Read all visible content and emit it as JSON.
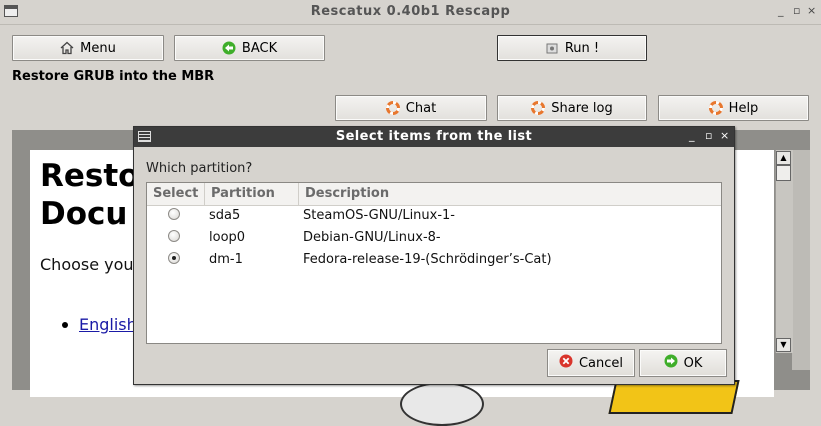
{
  "window": {
    "title": "Rescatux 0.40b1 Rescapp",
    "controls": [
      "_",
      "▫",
      "×"
    ]
  },
  "toolbar": {
    "menu_label": "Menu",
    "back_label": "BACK",
    "run_label": "Run !"
  },
  "page_heading": "Restore GRUB into the MBR",
  "actions": {
    "chat_label": "Chat",
    "share_log_label": "Share log",
    "help_label": "Help"
  },
  "browser": {
    "heading_line1": "Resto",
    "heading_line2": "Docu",
    "paragraph": "Choose you",
    "list_item": "English"
  },
  "dialog": {
    "title": "Select items from the list",
    "controls": [
      "_",
      "▫",
      "×"
    ],
    "question": "Which partition?",
    "columns": [
      "Select",
      "Partition",
      "Description"
    ],
    "rows": [
      {
        "selected": false,
        "partition": "sda5",
        "description": "SteamOS-GNU/Linux-1-"
      },
      {
        "selected": false,
        "partition": "loop0",
        "description": "Debian-GNU/Linux-8-"
      },
      {
        "selected": true,
        "partition": "dm-1",
        "description": "Fedora-release-19-(Schrödinger’s-Cat)"
      }
    ],
    "cancel_label": "Cancel",
    "ok_label": "OK"
  },
  "colors": {
    "dialog_titlebar": "#3c3c3c",
    "window_bg": "#d6d3ce",
    "cancel_icon": "#d9342b",
    "ok_icon": "#3fae2a",
    "lifebuoy_icon": "#e8772e"
  }
}
